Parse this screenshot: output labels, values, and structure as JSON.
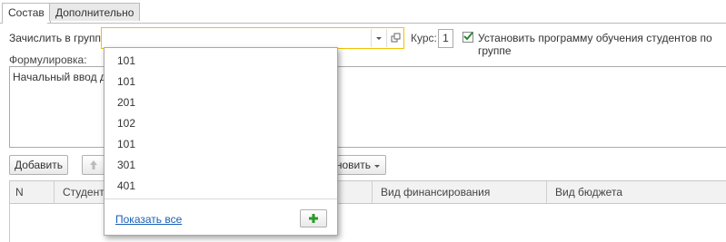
{
  "tabs": [
    {
      "label": "Состав",
      "active": true
    },
    {
      "label": "Дополнительно",
      "active": false
    }
  ],
  "group_field": {
    "label": "Зачислить в группу:",
    "value": ""
  },
  "course": {
    "label": "Курс:",
    "value": "1"
  },
  "program_checkbox": {
    "label": "Установить программу обучения студентов по группе",
    "checked": true
  },
  "formulation": {
    "label": "Формулировка:",
    "text": "Начальный ввод данных"
  },
  "toolbar": {
    "add_label": "Добавить",
    "install_label": "ановить"
  },
  "table": {
    "columns": [
      "N",
      "Студент",
      "Вид финансирования",
      "Вид бюджета"
    ]
  },
  "dropdown": {
    "items": [
      "101",
      "101",
      "201",
      "102",
      "101",
      "301",
      "401"
    ],
    "show_all_label": "Показать все"
  },
  "colors": {
    "accent": "#f2c100",
    "link": "#1a5fb4",
    "add_green": "#2a9a2a",
    "check_green": "#2a8a2a"
  }
}
